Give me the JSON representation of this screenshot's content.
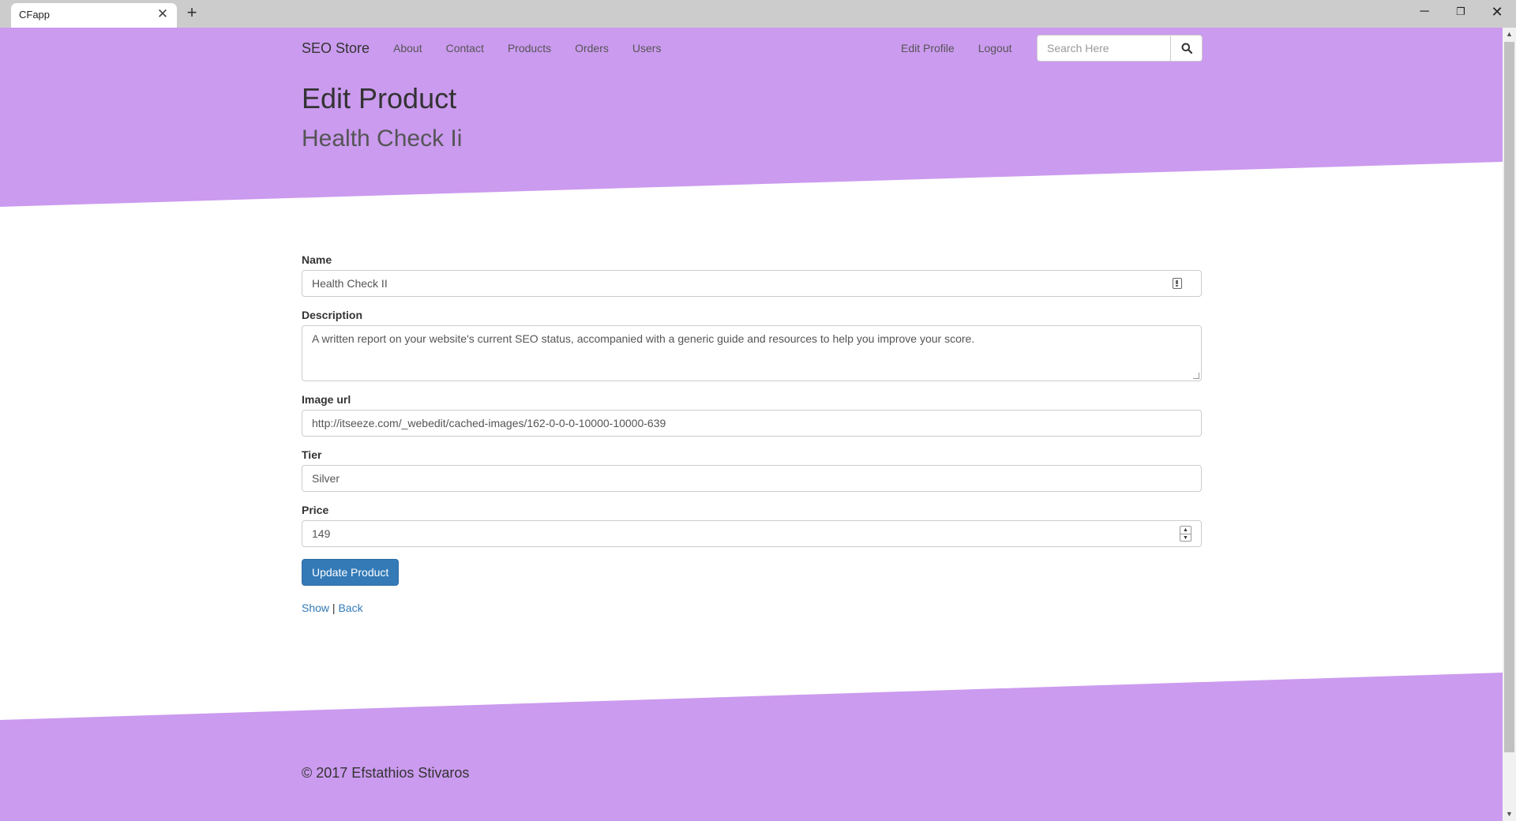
{
  "browser": {
    "tab_title": "CFapp",
    "tab_close": "✕",
    "new_tab": "+",
    "minimize": "─",
    "maximize": "❐",
    "close": "✕"
  },
  "colors": {
    "header_bg": "#cb9bef",
    "primary_button": "#337ab7"
  },
  "navbar": {
    "brand": "SEO Store",
    "left_links": [
      "About",
      "Contact",
      "Products",
      "Orders",
      "Users"
    ],
    "right_links": [
      "Edit Profile",
      "Logout"
    ],
    "search_placeholder": "Search Here"
  },
  "page": {
    "title": "Edit Product",
    "subtitle": "Health Check Ii"
  },
  "form": {
    "name": {
      "label": "Name",
      "value": "Health Check II"
    },
    "description": {
      "label": "Description",
      "value": "A written report on your website's current SEO status, accompanied with a generic guide and resources to help you improve your score."
    },
    "image_url": {
      "label": "Image url",
      "value": "http://itseeze.com/_webedit/cached-images/162-0-0-0-10000-10000-639"
    },
    "tier": {
      "label": "Tier",
      "value": "Silver"
    },
    "price": {
      "label": "Price",
      "value": "149"
    },
    "submit_label": "Update Product"
  },
  "links": {
    "show": "Show",
    "separator": "|",
    "back": "Back"
  },
  "footer": {
    "text": "© 2017 Efstathios Stivaros"
  }
}
